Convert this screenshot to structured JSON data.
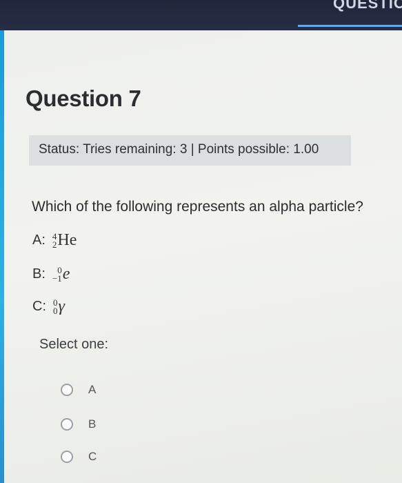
{
  "header": {
    "tab_label": "QUESTIO"
  },
  "question": {
    "title": "Question 7",
    "status": "Status: Tries remaining: 3 | Points possible: 1.00",
    "prompt": "Which of the following represents an alpha particle?",
    "answers": [
      {
        "label": "A:",
        "mass": "4",
        "atomic": "2",
        "symbol": "He"
      },
      {
        "label": "B:",
        "mass": "0",
        "atomic": "−1",
        "symbol": "e"
      },
      {
        "label": "C:",
        "mass": "0",
        "atomic": "0",
        "symbol": "γ"
      }
    ],
    "select_label": "Select one:",
    "options": [
      "A",
      "B",
      "C"
    ]
  }
}
